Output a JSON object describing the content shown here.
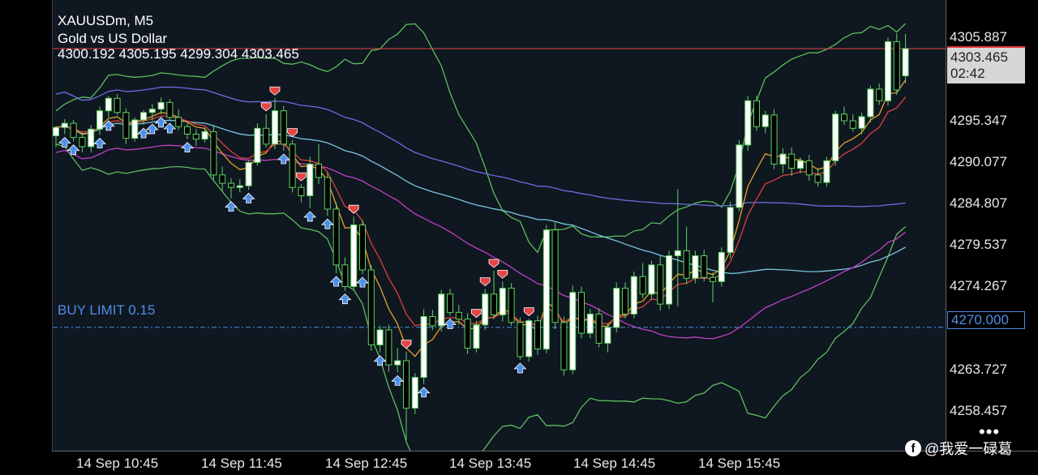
{
  "header": {
    "symbol": "XAUUSDm, M5",
    "description": "Gold vs US Dollar",
    "ohlc": "4300.192 4305.195 4299.304 4303.465"
  },
  "price_axis": {
    "labels": [
      "4305.887",
      "4295.347",
      "4290.077",
      "4284.807",
      "4279.537",
      "4274.267",
      "4263.727",
      "4258.457"
    ],
    "current_price": "4303.465",
    "countdown": "02:42",
    "limit_price": "4270.000"
  },
  "time_axis": {
    "labels": [
      "14 Sep 10:45",
      "14 Sep 11:45",
      "14 Sep 12:45",
      "14 Sep 13:45",
      "14 Sep 14:45",
      "14 Sep 15:45"
    ]
  },
  "order": {
    "buy_limit_label": "BUY LIMIT 0.15"
  },
  "watermark": {
    "text": "@我爱一碌葛",
    "icon": "facebook-icon"
  },
  "more_menu": {
    "icon": "more-dots-icon",
    "glyph": "•••"
  },
  "colors": {
    "background": "#0f1721",
    "bull_candle": "#ffffff",
    "bear_candle": "#000000",
    "wick": "#5fd35f",
    "sell_arrow": "#e64545",
    "buy_arrow": "#4a8fe8",
    "limit_line": "#4f8ee6",
    "bid_line": "#e64545"
  },
  "chart_data": {
    "type": "candlestick",
    "symbol": "XAUUSDm",
    "timeframe": "M5",
    "ylim": [
      4255.2,
      4309.3
    ],
    "grid": false,
    "x_ticks": [
      "14 Sep 10:45",
      "14 Sep 11:45",
      "14 Sep 12:45",
      "14 Sep 13:45",
      "14 Sep 14:45",
      "14 Sep 15:45"
    ],
    "y_ticks": [
      4305.887,
      4295.347,
      4290.077,
      4284.807,
      4279.537,
      4274.267,
      4263.727,
      4258.457
    ],
    "candles": [
      [
        4293.0,
        4294.2,
        4291.6,
        4294.0
      ],
      [
        4294.0,
        4295.0,
        4293.2,
        4294.5
      ],
      [
        4294.5,
        4294.9,
        4292.3,
        4292.8
      ],
      [
        4292.8,
        4293.4,
        4291.0,
        4291.7
      ],
      [
        4291.7,
        4294.3,
        4291.0,
        4293.8
      ],
      [
        4293.8,
        4296.5,
        4293.1,
        4296.0
      ],
      [
        4296.0,
        4297.8,
        4295.2,
        4297.5
      ],
      [
        4297.5,
        4298.0,
        4295.5,
        4295.8
      ],
      [
        4295.8,
        4296.3,
        4292.0,
        4292.7
      ],
      [
        4292.7,
        4295.2,
        4292.3,
        4294.9
      ],
      [
        4294.9,
        4296.1,
        4294.3,
        4295.8
      ],
      [
        4295.8,
        4296.8,
        4294.8,
        4296.2
      ],
      [
        4296.2,
        4297.6,
        4295.6,
        4297.0
      ],
      [
        4297.0,
        4297.4,
        4294.9,
        4295.2
      ],
      [
        4295.2,
        4296.2,
        4293.7,
        4294.1
      ],
      [
        4294.1,
        4294.5,
        4292.6,
        4293.2
      ],
      [
        4293.2,
        4293.8,
        4291.8,
        4292.6
      ],
      [
        4292.6,
        4294.0,
        4292.2,
        4293.5
      ],
      [
        4293.5,
        4294.3,
        4287.7,
        4288.3
      ],
      [
        4288.3,
        4289.3,
        4286.4,
        4287.3
      ],
      [
        4287.3,
        4287.9,
        4285.5,
        4286.8
      ],
      [
        4286.8,
        4287.8,
        4286.2,
        4287.0
      ],
      [
        4287.0,
        4290.0,
        4286.5,
        4289.8
      ],
      [
        4289.8,
        4294.5,
        4289.4,
        4293.9
      ],
      [
        4293.9,
        4295.6,
        4291.6,
        4292.0
      ],
      [
        4292.0,
        4297.5,
        4291.4,
        4296.0
      ],
      [
        4296.0,
        4296.6,
        4291.2,
        4292.0
      ],
      [
        4292.0,
        4292.5,
        4286.2,
        4286.8
      ],
      [
        4286.8,
        4287.2,
        4285.0,
        4285.8
      ],
      [
        4285.8,
        4290.5,
        4284.3,
        4289.6
      ],
      [
        4289.6,
        4292.0,
        4287.2,
        4288.0
      ],
      [
        4288.0,
        4288.6,
        4283.4,
        4284.2
      ],
      [
        4284.2,
        4285.0,
        4276.5,
        4277.5
      ],
      [
        4277.5,
        4278.4,
        4274.4,
        4274.9
      ],
      [
        4274.9,
        4283.3,
        4274.4,
        4282.3
      ],
      [
        4282.3,
        4282.9,
        4276.4,
        4276.9
      ],
      [
        4276.9,
        4277.5,
        4267.2,
        4267.9
      ],
      [
        4267.9,
        4270.2,
        4267.0,
        4269.7
      ],
      [
        4269.7,
        4270.3,
        4264.7,
        4265.5
      ],
      [
        4265.5,
        4267.5,
        4264.6,
        4266.0
      ],
      [
        4266.0,
        4267.1,
        4256.5,
        4260.3
      ],
      [
        4260.3,
        4264.5,
        4259.6,
        4264.0
      ],
      [
        4264.0,
        4272.2,
        4263.2,
        4271.3
      ],
      [
        4271.3,
        4272.1,
        4269.7,
        4270.2
      ],
      [
        4270.2,
        4274.5,
        4269.5,
        4274.0
      ],
      [
        4274.0,
        4274.6,
        4271.4,
        4271.8
      ],
      [
        4271.8,
        4272.7,
        4270.3,
        4271.0
      ],
      [
        4271.0,
        4271.7,
        4266.8,
        4267.5
      ],
      [
        4267.5,
        4270.8,
        4267.0,
        4270.3
      ],
      [
        4270.3,
        4274.6,
        4269.7,
        4274.0
      ],
      [
        4274.0,
        4276.8,
        4271.0,
        4271.5
      ],
      [
        4271.5,
        4275.5,
        4270.7,
        4274.7
      ],
      [
        4274.7,
        4275.3,
        4270.2,
        4270.6
      ],
      [
        4270.6,
        4271.2,
        4266.1,
        4266.5
      ],
      [
        4266.5,
        4271.0,
        4265.9,
        4270.8
      ],
      [
        4270.8,
        4271.4,
        4266.7,
        4267.4
      ],
      [
        4267.4,
        4282.3,
        4266.9,
        4281.7
      ],
      [
        4281.7,
        4282.6,
        4269.8,
        4270.6
      ],
      [
        4270.6,
        4271.3,
        4264.2,
        4264.9
      ],
      [
        4264.9,
        4275.0,
        4264.4,
        4274.2
      ],
      [
        4274.2,
        4274.9,
        4268.7,
        4269.3
      ],
      [
        4269.3,
        4272.2,
        4268.7,
        4271.6
      ],
      [
        4271.6,
        4272.3,
        4267.6,
        4268.1
      ],
      [
        4268.1,
        4270.5,
        4267.0,
        4270.0
      ],
      [
        4270.0,
        4275.4,
        4269.4,
        4274.7
      ],
      [
        4274.7,
        4275.4,
        4271.1,
        4271.6
      ],
      [
        4271.6,
        4276.7,
        4271.1,
        4276.1
      ],
      [
        4276.1,
        4277.7,
        4273.5,
        4274.0
      ],
      [
        4274.0,
        4278.0,
        4273.3,
        4277.5
      ],
      [
        4277.5,
        4278.6,
        4272.0,
        4272.8
      ],
      [
        4272.8,
        4279.2,
        4272.2,
        4278.6
      ],
      [
        4278.6,
        4286.6,
        4272.5,
        4279.2
      ],
      [
        4279.2,
        4282.1,
        4275.2,
        4275.9
      ],
      [
        4275.9,
        4279.2,
        4275.3,
        4278.6
      ],
      [
        4278.6,
        4279.3,
        4275.5,
        4276.0
      ],
      [
        4276.0,
        4276.6,
        4273.0,
        4275.5
      ],
      [
        4275.5,
        4279.6,
        4274.9,
        4279.0
      ],
      [
        4279.0,
        4285.1,
        4278.3,
        4284.4
      ],
      [
        4284.4,
        4292.5,
        4283.9,
        4291.9
      ],
      [
        4291.9,
        4297.8,
        4291.2,
        4297.2
      ],
      [
        4297.2,
        4297.8,
        4293.6,
        4294.1
      ],
      [
        4294.1,
        4296.0,
        4293.3,
        4295.5
      ],
      [
        4295.5,
        4296.2,
        4289.0,
        4289.6
      ],
      [
        4289.6,
        4291.5,
        4288.5,
        4290.8
      ],
      [
        4290.8,
        4291.6,
        4288.2,
        4289.1
      ],
      [
        4289.1,
        4290.4,
        4288.5,
        4290.0
      ],
      [
        4290.0,
        4290.7,
        4287.6,
        4288.3
      ],
      [
        4288.3,
        4289.1,
        4286.9,
        4287.4
      ],
      [
        4287.4,
        4290.5,
        4286.9,
        4290.0
      ],
      [
        4290.0,
        4296.0,
        4289.4,
        4295.6
      ],
      [
        4295.6,
        4296.5,
        4294.3,
        4294.8
      ],
      [
        4294.8,
        4295.6,
        4293.5,
        4293.9
      ],
      [
        4293.9,
        4295.8,
        4293.2,
        4295.3
      ],
      [
        4295.3,
        4299.0,
        4294.6,
        4298.6
      ],
      [
        4298.6,
        4299.3,
        4296.7,
        4297.2
      ],
      [
        4297.2,
        4304.8,
        4296.6,
        4304.3
      ],
      [
        4304.3,
        4305.3,
        4297.9,
        4298.5
      ],
      [
        4300.192,
        4305.195,
        4299.304,
        4303.465
      ]
    ],
    "sell_arrows": [
      24,
      25,
      27,
      28,
      34,
      40,
      48,
      49,
      50,
      51,
      54
    ],
    "buy_arrows": [
      1,
      2,
      5,
      6,
      10,
      11,
      12,
      13,
      15,
      20,
      22,
      26,
      29,
      31,
      32,
      33,
      35,
      37,
      39,
      42,
      45,
      53
    ]
  }
}
